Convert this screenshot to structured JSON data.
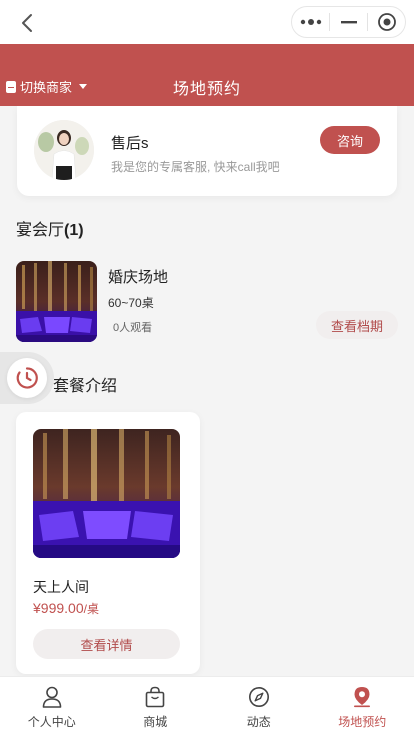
{
  "header": {
    "switch_label": "切换商家",
    "title": "场地预约"
  },
  "customer_service": {
    "name": "售后s",
    "description": "我是您的专属客服, 快来call我吧",
    "consult_label": "咨询"
  },
  "banquet_section": {
    "title": "宴会厅",
    "count": "(1)",
    "venues": [
      {
        "name": "婚庆场地",
        "capacity": "60~70桌",
        "views": "0人观看",
        "action_label": "查看档期"
      }
    ]
  },
  "package_section": {
    "title": "套餐介绍",
    "packages": [
      {
        "name": "天上人间",
        "price": "¥999.00",
        "unit": "/桌",
        "action_label": "查看详情"
      }
    ]
  },
  "tabbar": {
    "items": [
      {
        "label": "个人中心",
        "icon": "person-icon",
        "active": false
      },
      {
        "label": "商城",
        "icon": "shopping-bag-icon",
        "active": false
      },
      {
        "label": "动态",
        "icon": "compass-icon",
        "active": false
      },
      {
        "label": "场地预约",
        "icon": "location-pin-icon",
        "active": true
      }
    ]
  },
  "colors": {
    "accent": "#c0514f",
    "button_bg": "#f1eeee",
    "page_bg": "#f4f4f4"
  }
}
